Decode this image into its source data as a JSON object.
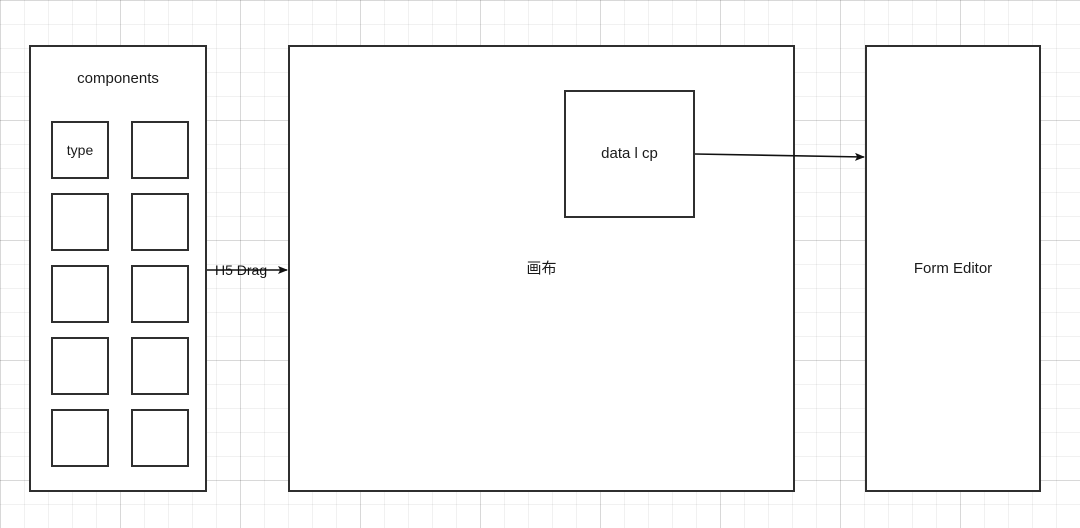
{
  "diagram": {
    "title": "H5 drag-and-drop form builder architecture",
    "background": {
      "color": "#ffffff",
      "grid_minor_color": "#efefef",
      "grid_major_color": "#e6e6e6",
      "grid_minor_size": 24,
      "grid_major_size": 120
    },
    "stroke_color": "#2f2f2f",
    "text_color": "#1a1a1a"
  },
  "components_panel": {
    "title": "components",
    "tiles": [
      {
        "label": "type"
      },
      {
        "label": ""
      },
      {
        "label": ""
      },
      {
        "label": ""
      },
      {
        "label": ""
      },
      {
        "label": ""
      },
      {
        "label": ""
      },
      {
        "label": ""
      },
      {
        "label": ""
      },
      {
        "label": ""
      }
    ]
  },
  "canvas_box": {
    "label": "画布"
  },
  "datacp_box": {
    "label": "data l cp"
  },
  "form_editor_box": {
    "label": "Form Editor"
  },
  "connectors": [
    {
      "name": "h5-drag-connector",
      "label": "H5 Drag",
      "from": "components-panel",
      "to": "canvas-box"
    },
    {
      "name": "datacp-to-form-editor-connector",
      "label": "",
      "from": "datacp-box",
      "to": "form-editor-box"
    }
  ]
}
